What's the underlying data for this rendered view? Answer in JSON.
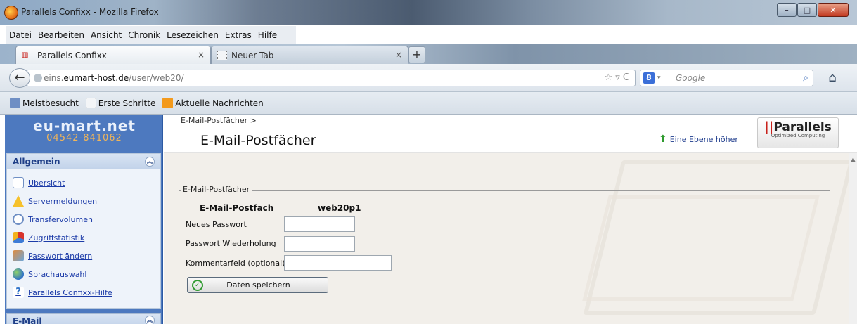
{
  "window": {
    "title": "Parallels Confixx - Mozilla Firefox",
    "minimize": "–",
    "maximize": "□",
    "close": "✕"
  },
  "menu": [
    "Datei",
    "Bearbeiten",
    "Ansicht",
    "Chronik",
    "Lesezeichen",
    "Extras",
    "Hilfe"
  ],
  "tabs": [
    {
      "label": "Parallels Confixx",
      "close": "×"
    },
    {
      "label": "Neuer Tab",
      "close": "×"
    }
  ],
  "newtab": "+",
  "address": {
    "prefix": "eins.",
    "host": "eumart-host.de",
    "path": "/user/web20/"
  },
  "search": {
    "placeholder": "Google"
  },
  "bookmarks": [
    "Meistbesucht",
    "Erste Schritte",
    "Aktuelle Nachrichten"
  ],
  "sidebar": {
    "brand": "eu-mart.net",
    "phone": "04542-841062",
    "section_title": "Allgemein",
    "items": [
      {
        "label": "Übersicht",
        "icon": "document-icon"
      },
      {
        "label": "Servermeldungen",
        "icon": "warning-icon"
      },
      {
        "label": "Transfervolumen",
        "icon": "transfer-icon"
      },
      {
        "label": "Zugriffstatistik",
        "icon": "statistics-icon"
      },
      {
        "label": "Passwort ändern",
        "icon": "password-icon"
      },
      {
        "label": "Sprachauswahl",
        "icon": "globe-icon"
      },
      {
        "label": "Parallels Confixx-Hilfe",
        "icon": "help-icon"
      }
    ],
    "section2_title": "E-Mail"
  },
  "header": {
    "breadcrumb_link": "E-Mail-Postfächer",
    "breadcrumb_sep": ">",
    "title": "E-Mail-Postfächer",
    "up_link": "Eine Ebene höher",
    "logo_word": "Parallels",
    "logo_sub": "Optimized Computing"
  },
  "form": {
    "legend": "E-Mail-Postfächer",
    "mailbox_label": "E-Mail-Postfach",
    "mailbox_value": "web20p1",
    "new_password_label": "Neues Passwort",
    "password_repeat_label": "Passwort Wiederholung",
    "comment_label": "Kommentarfeld (optional)",
    "save_label": "Daten speichern"
  },
  "colors": {
    "sidebar_blue": "#4d79bf",
    "content_bg": "#f2efea",
    "link": "#1c3ba8",
    "brand_red": "#c8211b"
  }
}
